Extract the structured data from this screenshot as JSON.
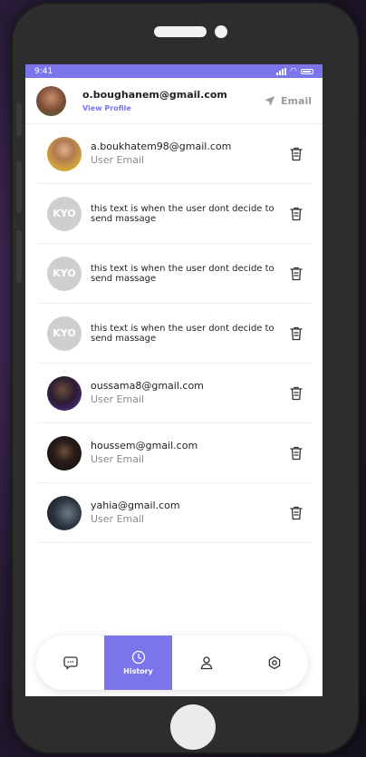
{
  "status": {
    "time": "9:41"
  },
  "header": {
    "email": "o.boughanem@gmail.com",
    "view_profile": "View Profile",
    "action_label": "Email"
  },
  "items": [
    {
      "avatar": "photo",
      "title": "a.boukhatem98@gmail.com",
      "subtitle": "User Email"
    },
    {
      "avatar_text": "KYO",
      "message": "this text is when the user dont decide to send massage"
    },
    {
      "avatar_text": "KYO",
      "message": "this text is when the user dont decide to send massage"
    },
    {
      "avatar_text": "KYO",
      "message": "this text is when the user dont decide to send massage"
    },
    {
      "avatar": "photo",
      "title": "oussama8@gmail.com",
      "subtitle": "User Email"
    },
    {
      "avatar": "photo",
      "title": "houssem@gmail.com",
      "subtitle": "User Email"
    },
    {
      "avatar": "photo",
      "title": "yahia@gmail.com",
      "subtitle": "User Email"
    }
  ],
  "nav": {
    "active_label": "History",
    "items": [
      "chat-icon",
      "history-icon",
      "profile-icon",
      "settings-icon"
    ]
  },
  "colors": {
    "accent": "#7b75ec",
    "background": "#2a1d3a"
  }
}
